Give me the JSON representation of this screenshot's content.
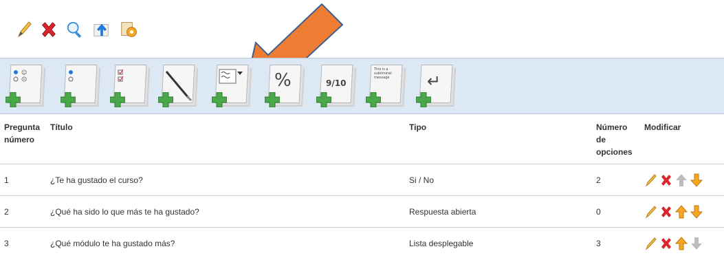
{
  "toolbar": {
    "icons": [
      "edit-icon",
      "delete-icon",
      "preview-icon",
      "export-icon",
      "settings-icon"
    ]
  },
  "question_types": [
    {
      "name": "yes-no-question-type",
      "glyph": ""
    },
    {
      "name": "single-choice-question-type",
      "glyph": ""
    },
    {
      "name": "multiple-choice-question-type",
      "glyph": ""
    },
    {
      "name": "open-answer-question-type",
      "glyph": ""
    },
    {
      "name": "dropdown-question-type",
      "glyph": ""
    },
    {
      "name": "percentage-question-type",
      "glyph": "%"
    },
    {
      "name": "score-question-type",
      "glyph": "9/10"
    },
    {
      "name": "message-question-type",
      "glyph": "This is a subliminal message"
    },
    {
      "name": "page-break-question-type",
      "glyph": "↵"
    }
  ],
  "table": {
    "headers": {
      "number": "Pregunta número",
      "title": "Título",
      "type": "Tipo",
      "options": "Número de opciones",
      "modify": "Modificar"
    },
    "rows": [
      {
        "number": "1",
        "title": "¿Te ha gustado el curso?",
        "type": "Si / No",
        "options": "2"
      },
      {
        "number": "2",
        "title": "¿Qué ha sido lo que más te ha gustado?",
        "type": "Respuesta abierta",
        "options": "0"
      },
      {
        "number": "3",
        "title": "¿Qué módulo te ha gustado más?",
        "type": "Lista desplegable",
        "options": "3"
      }
    ]
  },
  "colors": {
    "bar_bg": "#dde8f5",
    "arrow": "#ee7d33",
    "plus_green": "#4aa84a",
    "delete_red": "#d9262e",
    "up_orange": "#f5a623"
  }
}
